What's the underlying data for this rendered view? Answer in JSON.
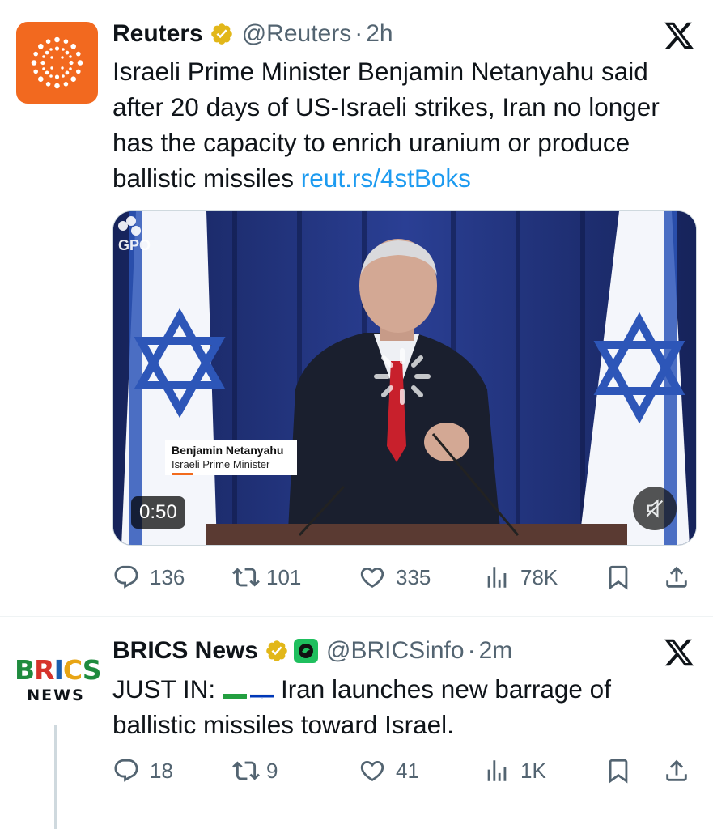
{
  "tweets": [
    {
      "author_name": "Reuters",
      "handle": "@Reuters",
      "separator": "·",
      "time": "2h",
      "text": "Israeli Prime Minister Benjamin Netanyahu said after 20 days of US-Israeli strikes, Iran no longer has the capacity to enrich uranium or produce ballistic missiles ",
      "link": "reut.rs/4stBoks",
      "media": {
        "watermark": "GPO",
        "lower_third_name": "Benjamin Netanyahu",
        "lower_third_title": "Israeli Prime Minister",
        "duration": "0:50"
      },
      "stats": {
        "replies": "136",
        "reposts": "101",
        "likes": "335",
        "views": "78K"
      }
    },
    {
      "author_name": "BRICS News",
      "handle": "@BRICSinfo",
      "separator": "·",
      "time": "2m",
      "avatar_word": "BRICS",
      "avatar_sub": "NEWS",
      "text_prefix": "JUST IN: ",
      "text": "Iran launches new barrage of ballistic missiles toward Israel.",
      "stats": {
        "replies": "18",
        "reposts": "9",
        "likes": "41",
        "views": "1K"
      }
    }
  ],
  "icons": {
    "verified": "verified-gold-badge-icon",
    "x_logo": "x-logo-icon",
    "reply": "reply-bubble-icon",
    "repost": "repost-icon",
    "like": "heart-icon",
    "views": "views-bar-chart-icon",
    "bookmark": "bookmark-icon",
    "share": "share-upload-icon",
    "mute": "muted-speaker-icon",
    "flags": [
      "iran-flag-icon",
      "israel-flag-icon"
    ]
  },
  "colors": {
    "reuters_orange": "#f2691f",
    "verified_gold": "#e2b719",
    "link_blue": "#1d9bf0",
    "secondary_text": "#536471"
  }
}
